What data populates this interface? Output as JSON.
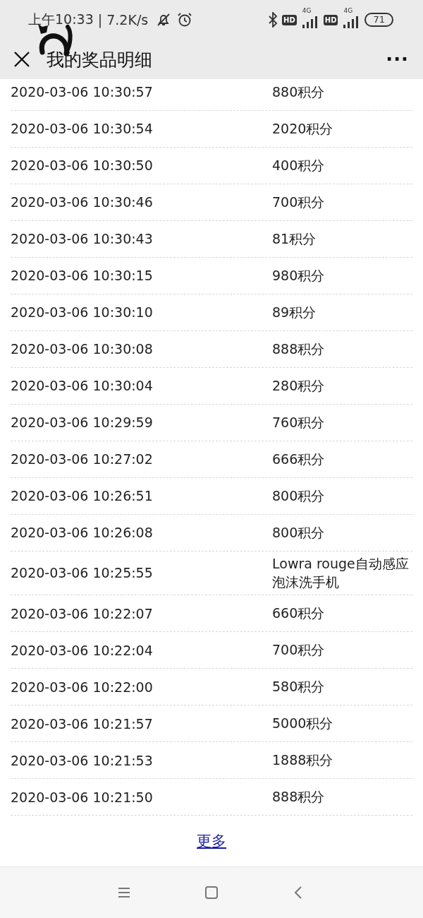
{
  "status_bar": {
    "time": "上午10:33",
    "speed": "| 7.2K/s",
    "badges": [
      "HD",
      "HD"
    ],
    "network": [
      "4G",
      "4G"
    ],
    "battery": "71"
  },
  "header": {
    "title": "我的奖品明细",
    "menu": "···"
  },
  "rows": [
    {
      "time": "2020-03-06 10:30:57",
      "prize": "880积分"
    },
    {
      "time": "2020-03-06 10:30:54",
      "prize": "2020积分"
    },
    {
      "time": "2020-03-06 10:30:50",
      "prize": "400积分"
    },
    {
      "time": "2020-03-06 10:30:46",
      "prize": "700积分"
    },
    {
      "time": "2020-03-06 10:30:43",
      "prize": "81积分"
    },
    {
      "time": "2020-03-06 10:30:15",
      "prize": "980积分"
    },
    {
      "time": "2020-03-06 10:30:10",
      "prize": "89积分"
    },
    {
      "time": "2020-03-06 10:30:08",
      "prize": "888积分"
    },
    {
      "time": "2020-03-06 10:30:04",
      "prize": "280积分"
    },
    {
      "time": "2020-03-06 10:29:59",
      "prize": "760积分"
    },
    {
      "time": "2020-03-06 10:27:02",
      "prize": "666积分"
    },
    {
      "time": "2020-03-06 10:26:51",
      "prize": "800积分"
    },
    {
      "time": "2020-03-06 10:26:08",
      "prize": "800积分"
    },
    {
      "time": "2020-03-06 10:25:55",
      "prize": "Lowra rouge自动感应泡沫洗手机"
    },
    {
      "time": "2020-03-06 10:22:07",
      "prize": "660积分"
    },
    {
      "time": "2020-03-06 10:22:04",
      "prize": "700积分"
    },
    {
      "time": "2020-03-06 10:22:00",
      "prize": "580积分"
    },
    {
      "time": "2020-03-06 10:21:57",
      "prize": "5000积分"
    },
    {
      "time": "2020-03-06 10:21:53",
      "prize": "1888积分"
    },
    {
      "time": "2020-03-06 10:21:50",
      "prize": "888积分"
    }
  ],
  "more_link": "更多"
}
